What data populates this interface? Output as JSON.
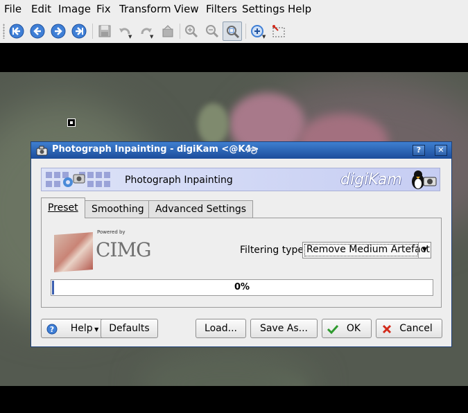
{
  "menubar": {
    "items": [
      "File",
      "Edit",
      "Image",
      "Fix",
      "Transform",
      "View",
      "Filters",
      "Settings",
      "Help"
    ]
  },
  "toolbar": {
    "icons": [
      "first-icon",
      "back-icon",
      "forward-icon",
      "last-icon",
      "save-icon",
      "undo-icon",
      "redo-icon",
      "revert-icon",
      "zoom-in-icon",
      "zoom-out-icon",
      "zoom-fit-icon",
      "rotate-icon",
      "crop-icon"
    ]
  },
  "dialog": {
    "title": "Photograph Inpainting - digiKam <@K4>",
    "help_button": "?",
    "close_button": "✕",
    "header_title": "Photograph Inpainting",
    "brand": "digiKam",
    "tabs": [
      "Preset",
      "Smoothing",
      "Advanced Settings"
    ],
    "cimg": {
      "powered_by": "Powered by",
      "name": "CIMG"
    },
    "filter_label": "Filtering type:",
    "filter_value": "Remove Medium Artefact",
    "progress_text": "0%",
    "progress_value": 0,
    "buttons": {
      "help": "Help",
      "defaults": "Defaults",
      "load": "Load...",
      "save_as": "Save As...",
      "ok": "OK",
      "cancel": "Cancel"
    }
  },
  "colors": {
    "titlebar": "#2b5fa8",
    "header_banner": "#c6cdf3",
    "progress": "#3b5fb0",
    "ok_check": "#2e9a2e",
    "cancel_x": "#d22a1a"
  }
}
